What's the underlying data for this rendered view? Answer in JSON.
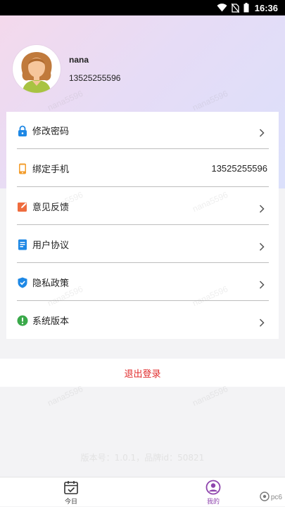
{
  "status_bar": {
    "time": "16:36"
  },
  "profile": {
    "username": "nana",
    "phone": "13525255596"
  },
  "menu": [
    {
      "label": "修改密码",
      "icon": "lock-icon",
      "color": "#1e88e5",
      "has_chevron": true
    },
    {
      "label": "绑定手机",
      "icon": "phone-icon",
      "color": "#f39c2a",
      "value": "13525255596",
      "has_chevron": false
    },
    {
      "label": "意见反馈",
      "icon": "edit-icon",
      "color": "#ef6c3e",
      "has_chevron": true
    },
    {
      "label": "用户协议",
      "icon": "document-icon",
      "color": "#1e88e5",
      "has_chevron": true
    },
    {
      "label": "隐私政策",
      "icon": "shield-icon",
      "color": "#1e88e5",
      "has_chevron": true
    },
    {
      "label": "系统版本",
      "icon": "alert-icon",
      "color": "#3aa94a",
      "has_chevron": true
    }
  ],
  "logout_label": "退出登录",
  "logout_color": "#e02b2b",
  "version_text": "版本号：1.0.1，品牌id：50821",
  "watermark_text": "nana5596",
  "tabs": [
    {
      "label": "今日",
      "icon": "calendar-check-icon",
      "active": false
    },
    {
      "label": "我的",
      "icon": "user-circle-icon",
      "active": true
    }
  ],
  "active_color": "#8e44ad",
  "corner_logo": "pc6"
}
